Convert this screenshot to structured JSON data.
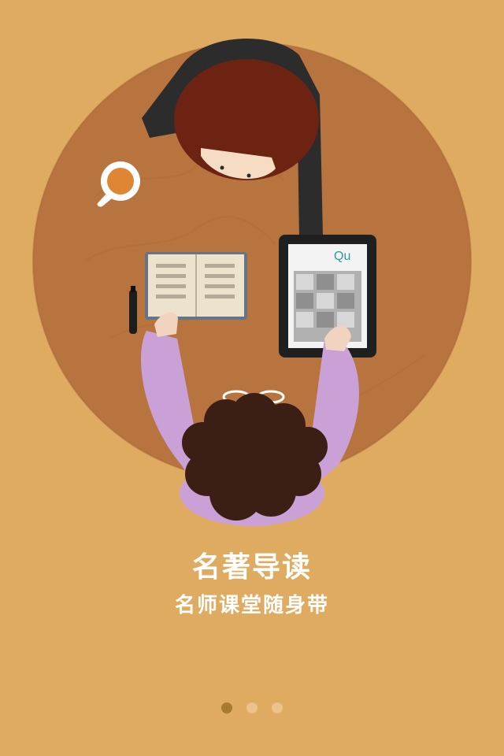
{
  "onboarding": {
    "title": "名著导读",
    "subtitle": "名师课堂随身带",
    "pages_total": 3,
    "active_page": 1
  },
  "colors": {
    "background": "#dfab61",
    "table": "#b8743f",
    "dot_active": "#a87a2f",
    "dot_inactive": "#ebc28b",
    "text": "#ffffff"
  },
  "illustration": {
    "tablet_logo_text": "Qu"
  }
}
